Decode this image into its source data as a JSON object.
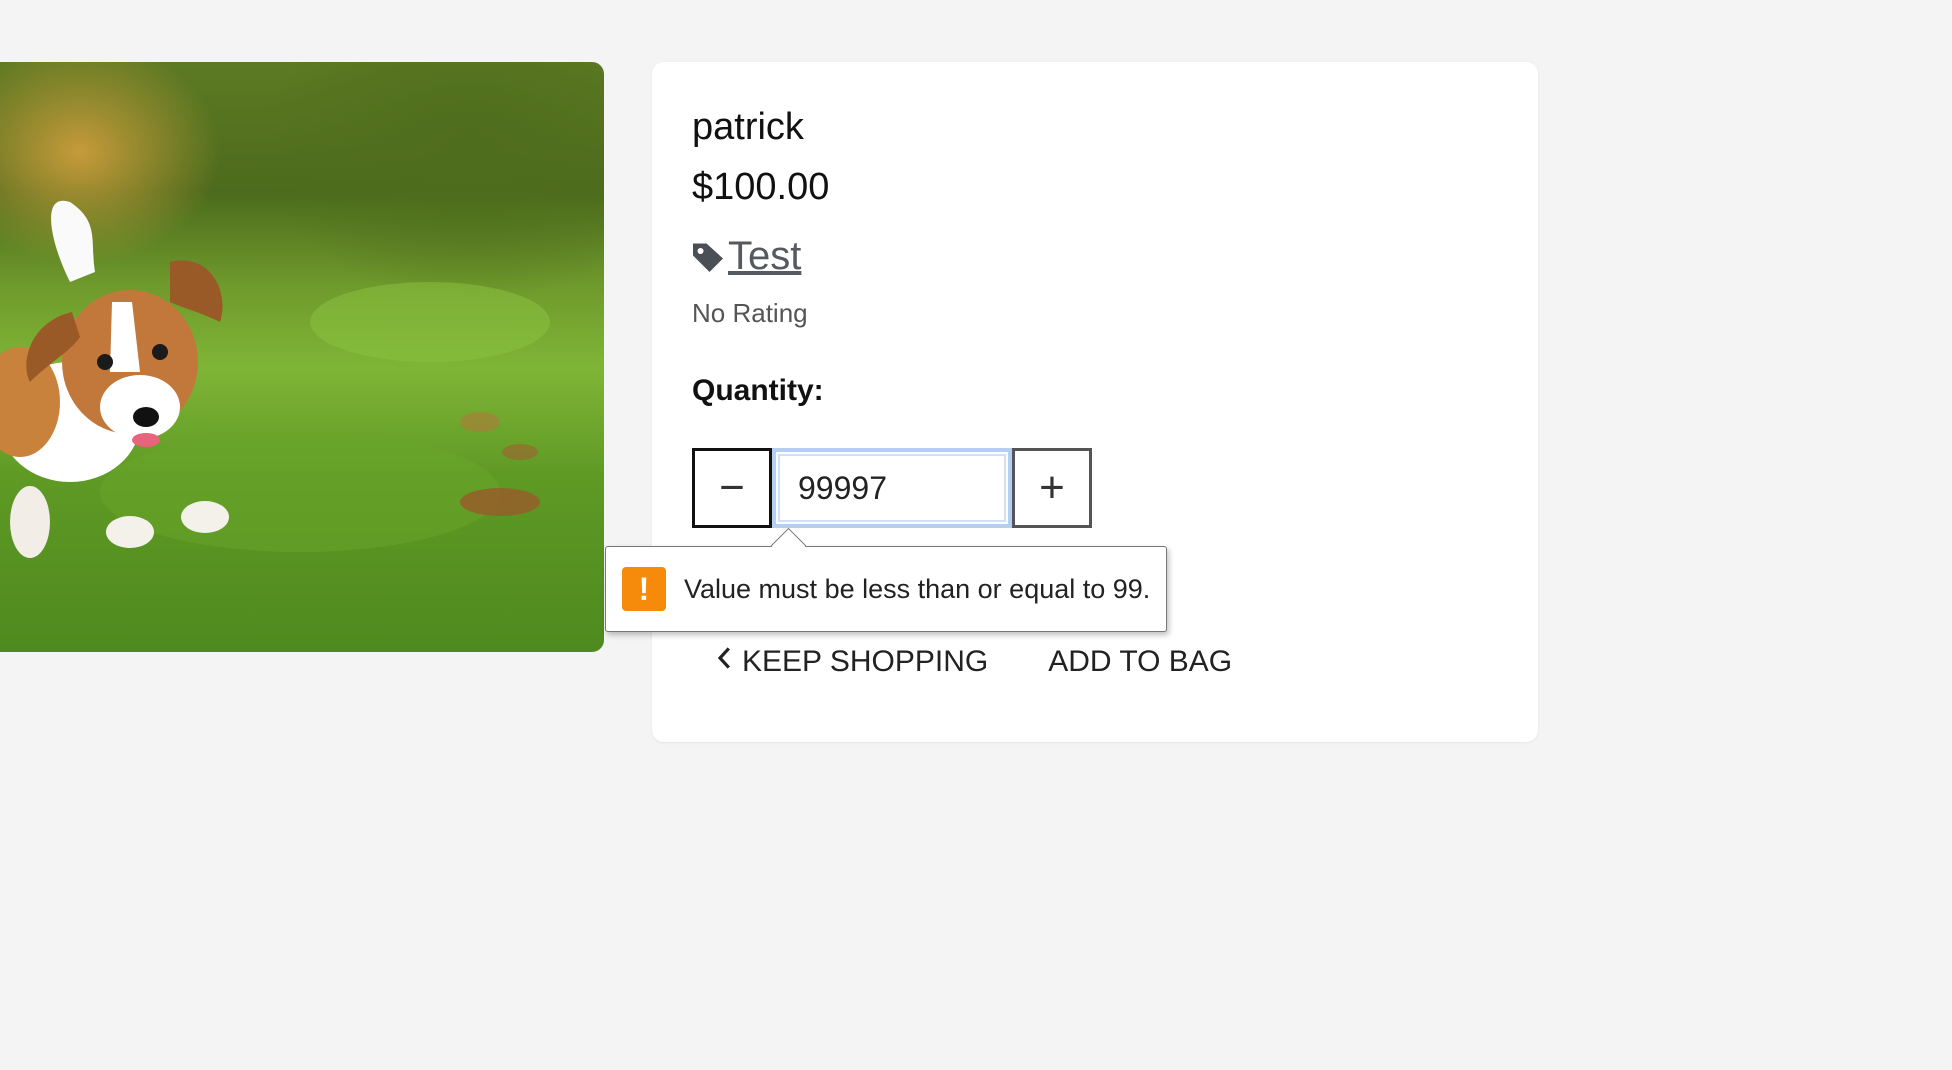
{
  "product": {
    "name": "patrick",
    "price": "$100.00",
    "tag_label": "Test",
    "rating_text": "No Rating"
  },
  "quantity": {
    "label": "Quantity:",
    "value": "99997",
    "minus_symbol": "−",
    "plus_symbol": "+"
  },
  "validation": {
    "icon_symbol": "!",
    "message": "Value must be less than or equal to 99.",
    "accent_color": "#f58a0b"
  },
  "actions": {
    "keep_shopping_label": "KEEP SHOPPING",
    "add_to_bag_label": "ADD TO BAG"
  },
  "icons": {
    "tag": "tag-icon",
    "back": "chevron-left-icon",
    "warning": "warning-icon"
  }
}
